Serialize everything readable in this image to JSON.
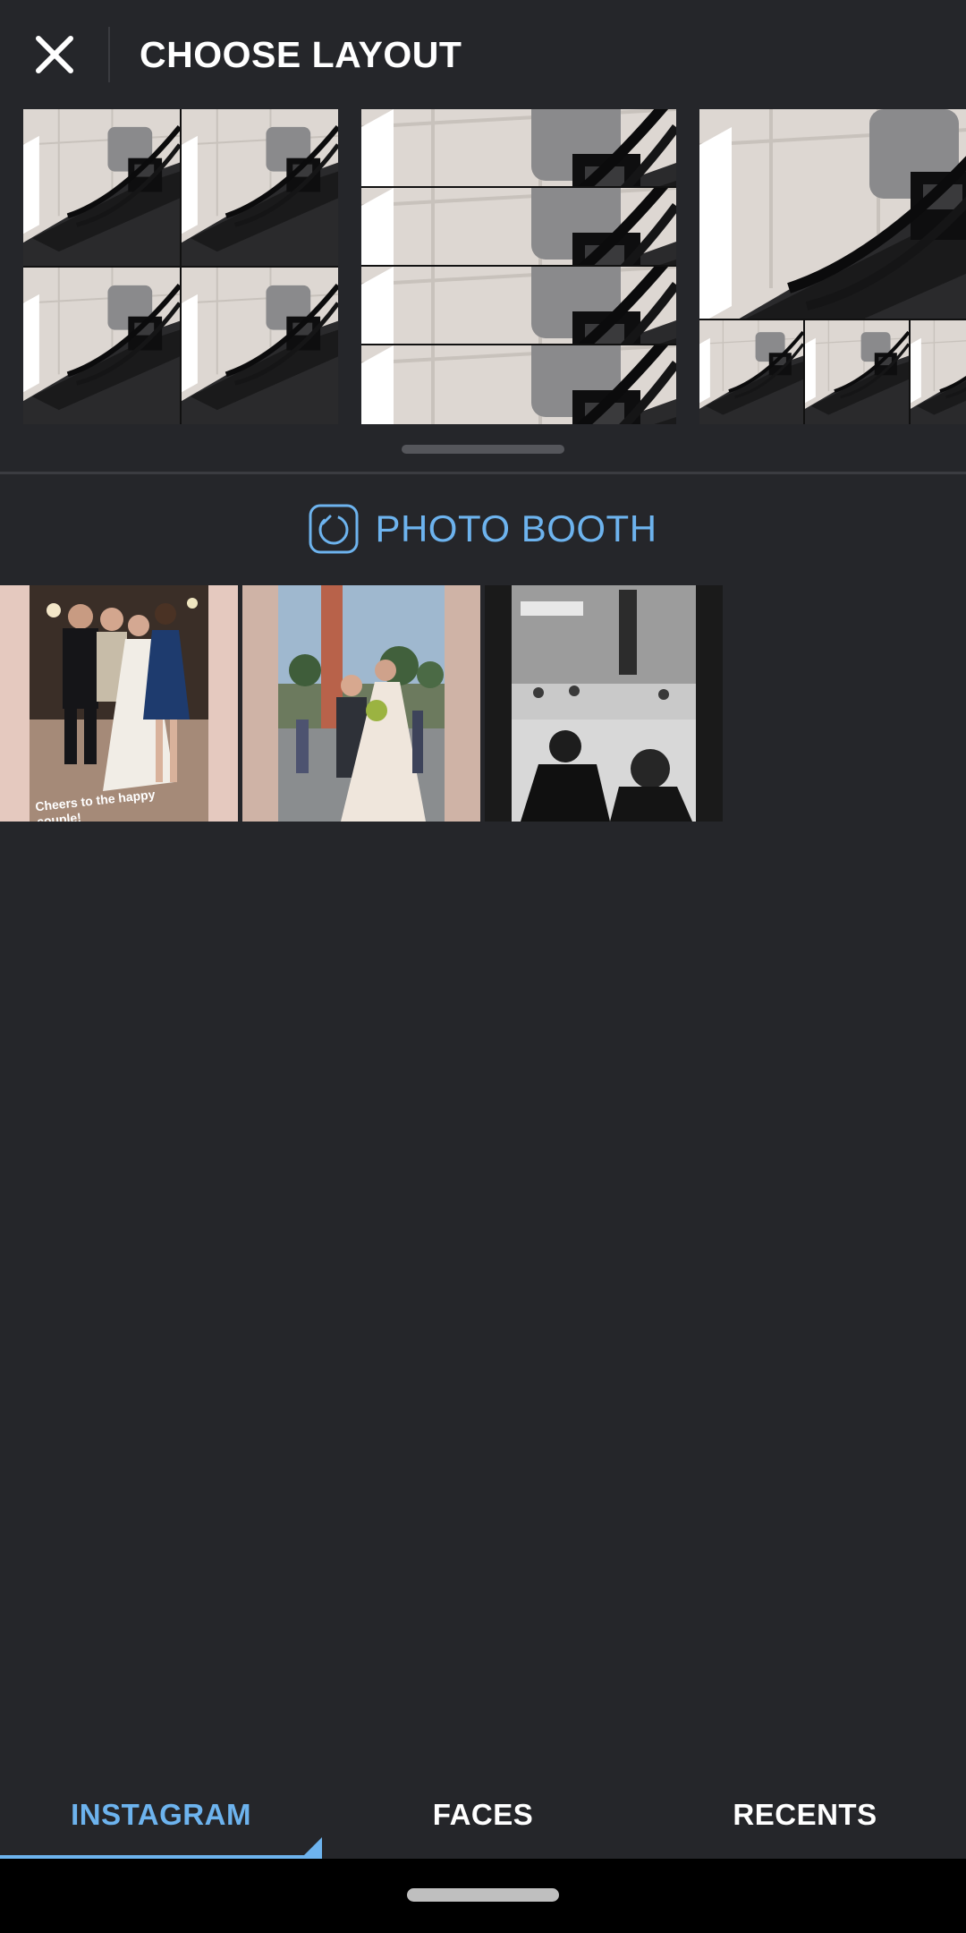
{
  "header": {
    "title": "CHOOSE LAYOUT",
    "close_icon": "close-icon"
  },
  "layouts": [
    {
      "name": "grid-2x2",
      "tiles": 4
    },
    {
      "name": "stack-4-rows",
      "tiles": 4
    },
    {
      "name": "one-big-three-small",
      "tiles": 4
    }
  ],
  "photo_booth": {
    "label": "PHOTO BOOTH",
    "icon": "photo-booth-icon"
  },
  "photos": [
    {
      "name": "wedding-group-photo",
      "caption": "Cheers to the happy couple!"
    },
    {
      "name": "wedding-bride-outdoor",
      "caption": ""
    },
    {
      "name": "wedding-dance-bw",
      "caption": ""
    }
  ],
  "tabs": [
    {
      "label": "INSTAGRAM",
      "active": true
    },
    {
      "label": "FACES",
      "active": false
    },
    {
      "label": "RECENTS",
      "active": false
    }
  ],
  "colors": {
    "background": "#25262a",
    "accent": "#6db3ee",
    "nav_bar": "#000000"
  }
}
